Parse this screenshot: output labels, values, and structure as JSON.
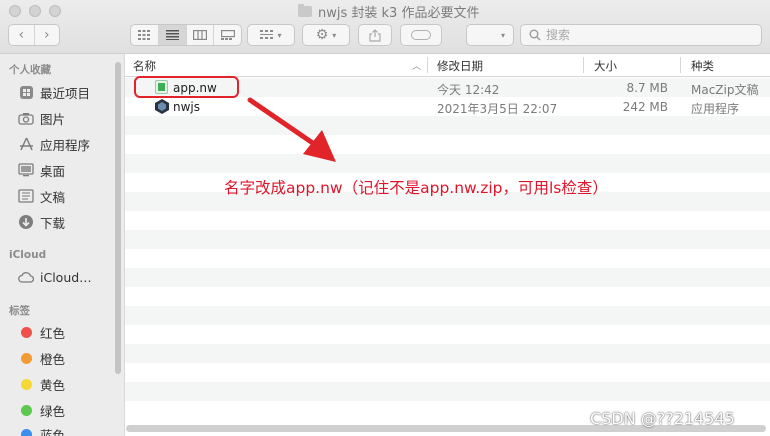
{
  "window": {
    "title": "nwjs 封装 k3 作品必要文件"
  },
  "toolbar": {
    "back": "‹",
    "forward": "›",
    "search_placeholder": "搜索"
  },
  "sidebar": {
    "favorites_header": "个人收藏",
    "favorites": [
      {
        "label": "最近项目",
        "icon": "recents-icon"
      },
      {
        "label": "图片",
        "icon": "camera-icon"
      },
      {
        "label": "应用程序",
        "icon": "applications-icon"
      },
      {
        "label": "桌面",
        "icon": "desktop-icon"
      },
      {
        "label": "文稿",
        "icon": "documents-icon"
      },
      {
        "label": "下载",
        "icon": "downloads-icon"
      }
    ],
    "icloud_header": "iCloud",
    "icloud_items": [
      {
        "label": "iCloud…",
        "icon": "cloud-icon"
      }
    ],
    "tags_header": "标签",
    "tags": [
      {
        "label": "红色",
        "color": "#f0504a"
      },
      {
        "label": "橙色",
        "color": "#f49a35"
      },
      {
        "label": "黄色",
        "color": "#f5d735"
      },
      {
        "label": "绿色",
        "color": "#5cc84e"
      },
      {
        "label": "蓝色",
        "color": "#3c8df0"
      }
    ]
  },
  "columns": {
    "name": "名称",
    "date": "修改日期",
    "size": "大小",
    "kind": "种类"
  },
  "files": [
    {
      "name": "app.nw",
      "date": "今天 12:42",
      "size": "8.7 MB",
      "kind": "MacZip文稿",
      "icon": "zip-document-icon"
    },
    {
      "name": "nwjs",
      "date": "2021年3月5日 22:07",
      "size": "242 MB",
      "kind": "应用程序",
      "icon": "nwjs-app-icon"
    }
  ],
  "annotation": {
    "text": "名字改成app.nw（记住不是app.nw.zip，可用ls检查）",
    "color": "#e0142a"
  },
  "watermark": "CSDN @??214545"
}
